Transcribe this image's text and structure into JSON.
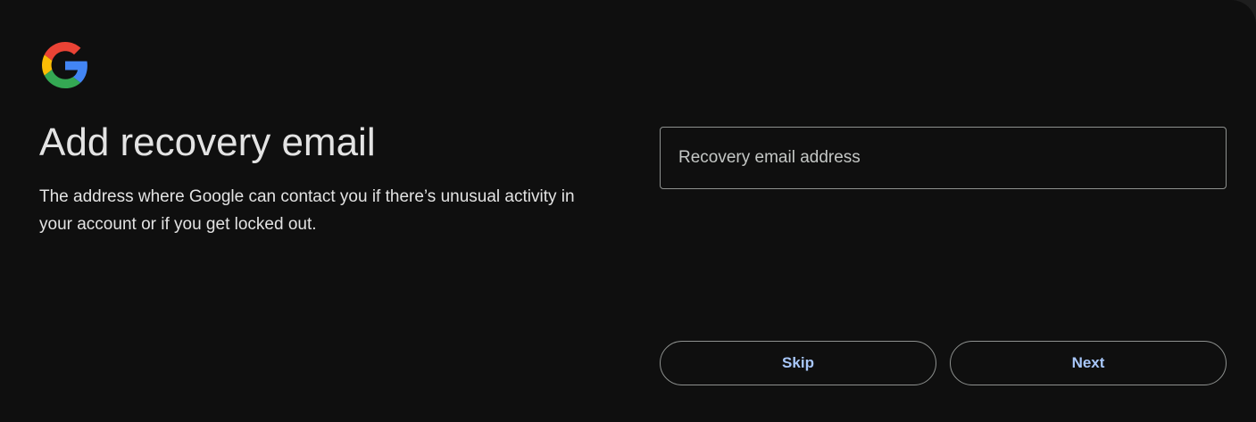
{
  "logo": {
    "icon": "google-g-logo-icon",
    "colors": {
      "red": "#EA4335",
      "yellow": "#FBBC05",
      "green": "#34A853",
      "blue": "#4285F4"
    }
  },
  "heading": "Add recovery email",
  "description": "The address where Google can contact you if there’s unusual activity in your account or if you get locked out.",
  "email_field": {
    "placeholder": "Recovery email address",
    "value": ""
  },
  "buttons": {
    "skip": "Skip",
    "next": "Next"
  },
  "theme": {
    "background": "#0f0f0f",
    "text": "#e3e3e3",
    "accent": "#a8c7fa",
    "border": "#8e918f"
  }
}
